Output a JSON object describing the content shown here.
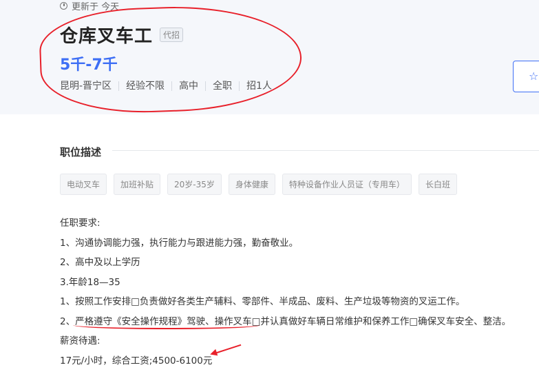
{
  "header": {
    "updated": "更新于 今天",
    "title": "仓库叉车工",
    "tag": "代招",
    "salary": "5千-7千",
    "meta": [
      "昆明-晋宁区",
      "经验不限",
      "高中",
      "全职",
      "招1人"
    ]
  },
  "section": {
    "title": "职位描述"
  },
  "skills": [
    "电动叉车",
    "加班补贴",
    "20岁-35岁",
    "身体健康",
    "特种设备作业人员证（专用车）",
    "长白班"
  ],
  "description": [
    "任职要求:",
    "1、沟通协调能力强，执行能力与跟进能力强，勤奋敬业。",
    "2、高中及以上学历",
    "3.年龄18—35",
    "1、按照工作安排□负责做好各类生产辅料、零部件、半成品、废料、生产垃圾等物资的叉运工作。",
    "2、严格遵守《安全操作规程》驾驶、操作叉车□并认真做好车辆日常维护和保养工作□确保叉车安全、整洁。",
    "薪资待遇:",
    "17元/小时，综合工资;4500-6100元"
  ],
  "colors": {
    "accent": "#3d6ef5",
    "annotation": "#e8202a"
  },
  "icons": {
    "updated": "clock-icon",
    "favorite": "star-icon"
  }
}
